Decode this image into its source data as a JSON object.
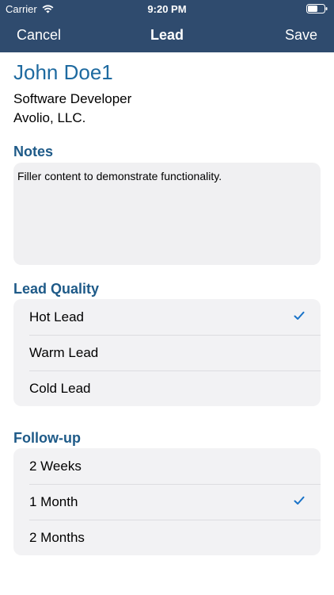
{
  "status_bar": {
    "carrier": "Carrier",
    "time": "9:20 PM"
  },
  "nav": {
    "cancel_label": "Cancel",
    "title": "Lead",
    "save_label": "Save"
  },
  "contact": {
    "name": "John Doe1",
    "job_title": "Software Developer",
    "company": "Avolio, LLC."
  },
  "notes": {
    "header": "Notes",
    "text": "Filler content to demonstrate functionality."
  },
  "lead_quality": {
    "header": "Lead Quality",
    "options": [
      {
        "label": "Hot Lead",
        "selected": true
      },
      {
        "label": "Warm Lead",
        "selected": false
      },
      {
        "label": "Cold Lead",
        "selected": false
      }
    ]
  },
  "follow_up": {
    "header": "Follow-up",
    "options": [
      {
        "label": "2 Weeks",
        "selected": false
      },
      {
        "label": "1 Month",
        "selected": true
      },
      {
        "label": "2 Months",
        "selected": false
      }
    ]
  },
  "colors": {
    "nav_background": "#2f4b6e",
    "accent": "#1e6aa0",
    "checkmark": "#1a73c8"
  },
  "icons": {
    "wifi": "wifi-icon",
    "battery": "battery-icon",
    "check": "checkmark-icon"
  }
}
